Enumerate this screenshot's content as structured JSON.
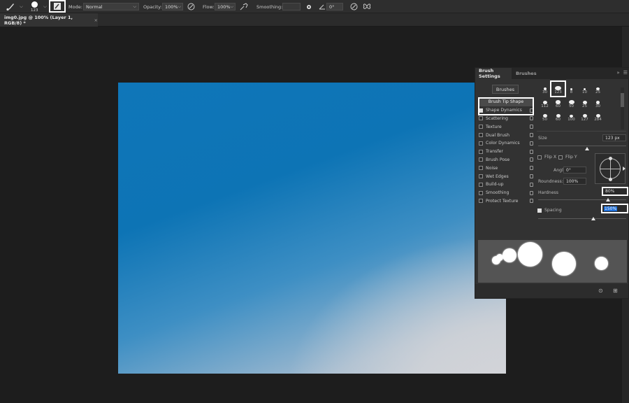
{
  "options_bar": {
    "brush_size": "123",
    "mode_label": "Mode:",
    "mode_value": "Normal",
    "opacity_label": "Opacity:",
    "opacity_value": "100%",
    "flow_label": "Flow:",
    "flow_value": "100%",
    "smoothing_label": "Smoothing:",
    "angle_value": "0°"
  },
  "document_tab": {
    "title": "img0.jpg @ 100% (Layer 1, RGB/8) *",
    "close": "×"
  },
  "panel": {
    "tabs": [
      "Brush Settings",
      "Brushes"
    ],
    "brushes_button": "Brushes",
    "options": [
      {
        "label": "Brush Tip Shape",
        "checkbox": false,
        "checked": false,
        "lock": false
      },
      {
        "label": "Shape Dynamics",
        "checkbox": true,
        "checked": true,
        "lock": true
      },
      {
        "label": "Scattering",
        "checkbox": true,
        "checked": false,
        "lock": true
      },
      {
        "label": "Texture",
        "checkbox": true,
        "checked": false,
        "lock": true
      },
      {
        "label": "Dual Brush",
        "checkbox": true,
        "checked": false,
        "lock": true
      },
      {
        "label": "Color Dynamics",
        "checkbox": true,
        "checked": false,
        "lock": true
      },
      {
        "label": "Transfer",
        "checkbox": true,
        "checked": false,
        "lock": true
      },
      {
        "label": "Brush Pose",
        "checkbox": true,
        "checked": false,
        "lock": true
      },
      {
        "label": "Noise",
        "checkbox": true,
        "checked": false,
        "lock": true
      },
      {
        "label": "Wet Edges",
        "checkbox": true,
        "checked": false,
        "lock": true
      },
      {
        "label": "Build-up",
        "checkbox": true,
        "checked": false,
        "lock": true
      },
      {
        "label": "Smoothing",
        "checkbox": true,
        "checked": false,
        "lock": true
      },
      {
        "label": "Protect Texture",
        "checkbox": true,
        "checked": false,
        "lock": true
      }
    ],
    "brush_presets": [
      "30",
      "123",
      "8",
      "10",
      "25",
      "112",
      "60",
      "50",
      "25",
      "30",
      "50",
      "60",
      "100",
      "127",
      "284"
    ],
    "size_label": "Size",
    "size_value": "123 px",
    "flip_x": "Flip X",
    "flip_y": "Flip Y",
    "angle_label": "Angle:",
    "angle_value": "0°",
    "roundness_label": "Roundness:",
    "roundness_value": "100%",
    "hardness_label": "Hardness",
    "hardness_value": "80%",
    "spacing_label": "Spacing",
    "spacing_checked": true,
    "spacing_value": "150%"
  },
  "colors": {
    "highlight": "#ffffff",
    "selection": "#1e6fd9"
  }
}
